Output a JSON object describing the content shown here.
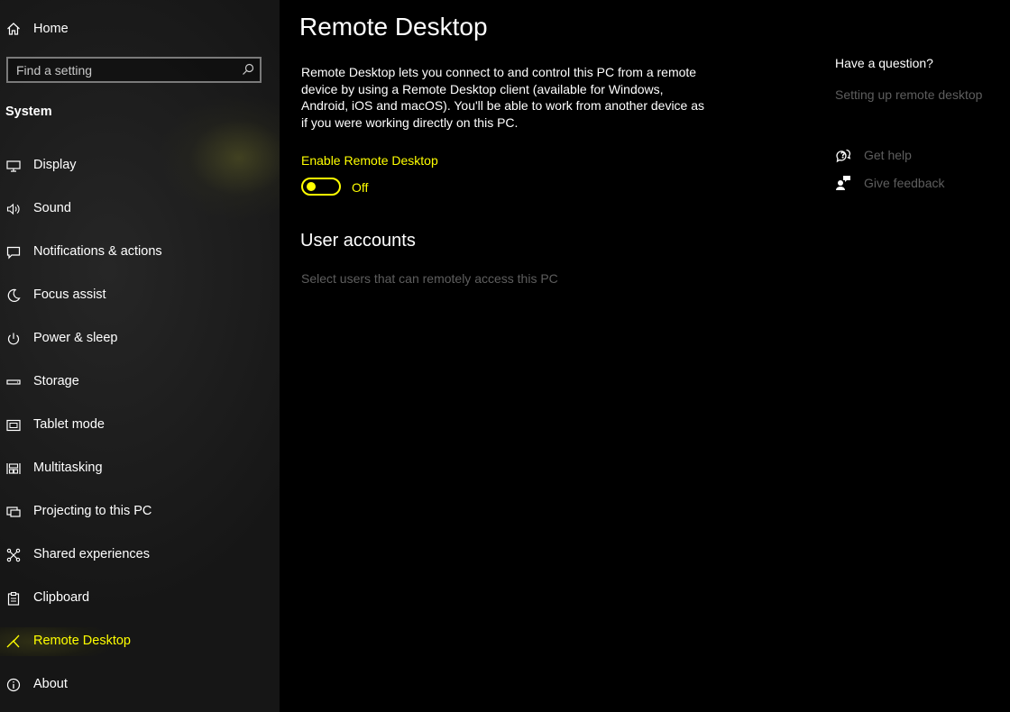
{
  "sidebar": {
    "home_label": "Home",
    "search_placeholder": "Find a setting",
    "section_heading": "System",
    "items": [
      {
        "label": "Display",
        "icon": "monitor-icon"
      },
      {
        "label": "Sound",
        "icon": "speaker-icon"
      },
      {
        "label": "Notifications & actions",
        "icon": "message-icon"
      },
      {
        "label": "Focus assist",
        "icon": "moon-icon"
      },
      {
        "label": "Power & sleep",
        "icon": "power-icon"
      },
      {
        "label": "Storage",
        "icon": "drive-icon"
      },
      {
        "label": "Tablet mode",
        "icon": "tablet-icon"
      },
      {
        "label": "Multitasking",
        "icon": "multitask-icon"
      },
      {
        "label": "Projecting to this PC",
        "icon": "project-icon"
      },
      {
        "label": "Shared experiences",
        "icon": "share-icon"
      },
      {
        "label": "Clipboard",
        "icon": "clipboard-icon"
      },
      {
        "label": "Remote Desktop",
        "icon": "remote-desktop-icon",
        "selected": true
      },
      {
        "label": "About",
        "icon": "info-icon"
      }
    ]
  },
  "main": {
    "title": "Remote Desktop",
    "description": "Remote Desktop lets you connect to and control this PC from a remote device by using a Remote Desktop client (available for Windows, Android, iOS and macOS). You'll be able to work from another device as if you were working directly on this PC.",
    "toggle_label": "Enable Remote Desktop",
    "toggle_state": "Off",
    "toggle_on": false,
    "user_accounts_heading": "User accounts",
    "select_users_link": "Select users that can remotely access this PC"
  },
  "help": {
    "heading": "Have a question?",
    "link": "Setting up remote desktop",
    "get_help": "Get help",
    "give_feedback": "Give feedback"
  },
  "colors": {
    "accent": "#ffff00",
    "disabled_text": "#5e5e5e",
    "background": "#000000",
    "sidebar": "#1e1e1e"
  }
}
